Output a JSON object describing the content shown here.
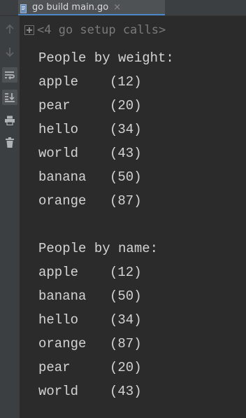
{
  "tab": {
    "title": "go build main.go",
    "close_glyph": "×"
  },
  "gutter": {
    "icons": [
      "arrow-up-icon",
      "arrow-down-icon",
      "soft-wrap-icon",
      "scroll-to-end-icon",
      "print-icon",
      "trash-icon"
    ]
  },
  "console": {
    "fold_text": "<4 go setup calls>",
    "sections": [
      {
        "heading": "People by weight:",
        "rows": [
          {
            "name": "apple",
            "weight": "(12)"
          },
          {
            "name": "pear",
            "weight": "(20)"
          },
          {
            "name": "hello",
            "weight": "(34)"
          },
          {
            "name": "world",
            "weight": "(43)"
          },
          {
            "name": "banana",
            "weight": "(50)"
          },
          {
            "name": "orange",
            "weight": "(87)"
          }
        ]
      },
      {
        "heading": "People by name:",
        "rows": [
          {
            "name": "apple",
            "weight": "(12)"
          },
          {
            "name": "banana",
            "weight": "(50)"
          },
          {
            "name": "hello",
            "weight": "(34)"
          },
          {
            "name": "orange",
            "weight": "(87)"
          },
          {
            "name": "pear",
            "weight": "(20)"
          },
          {
            "name": "world",
            "weight": "(43)"
          }
        ]
      }
    ]
  },
  "colors": {
    "background": "#2b2b2b",
    "panel": "#3c3f41",
    "text": "#d4d4d4",
    "fold_text": "#7a7a7a",
    "tab_underline": "#4a88c7"
  }
}
